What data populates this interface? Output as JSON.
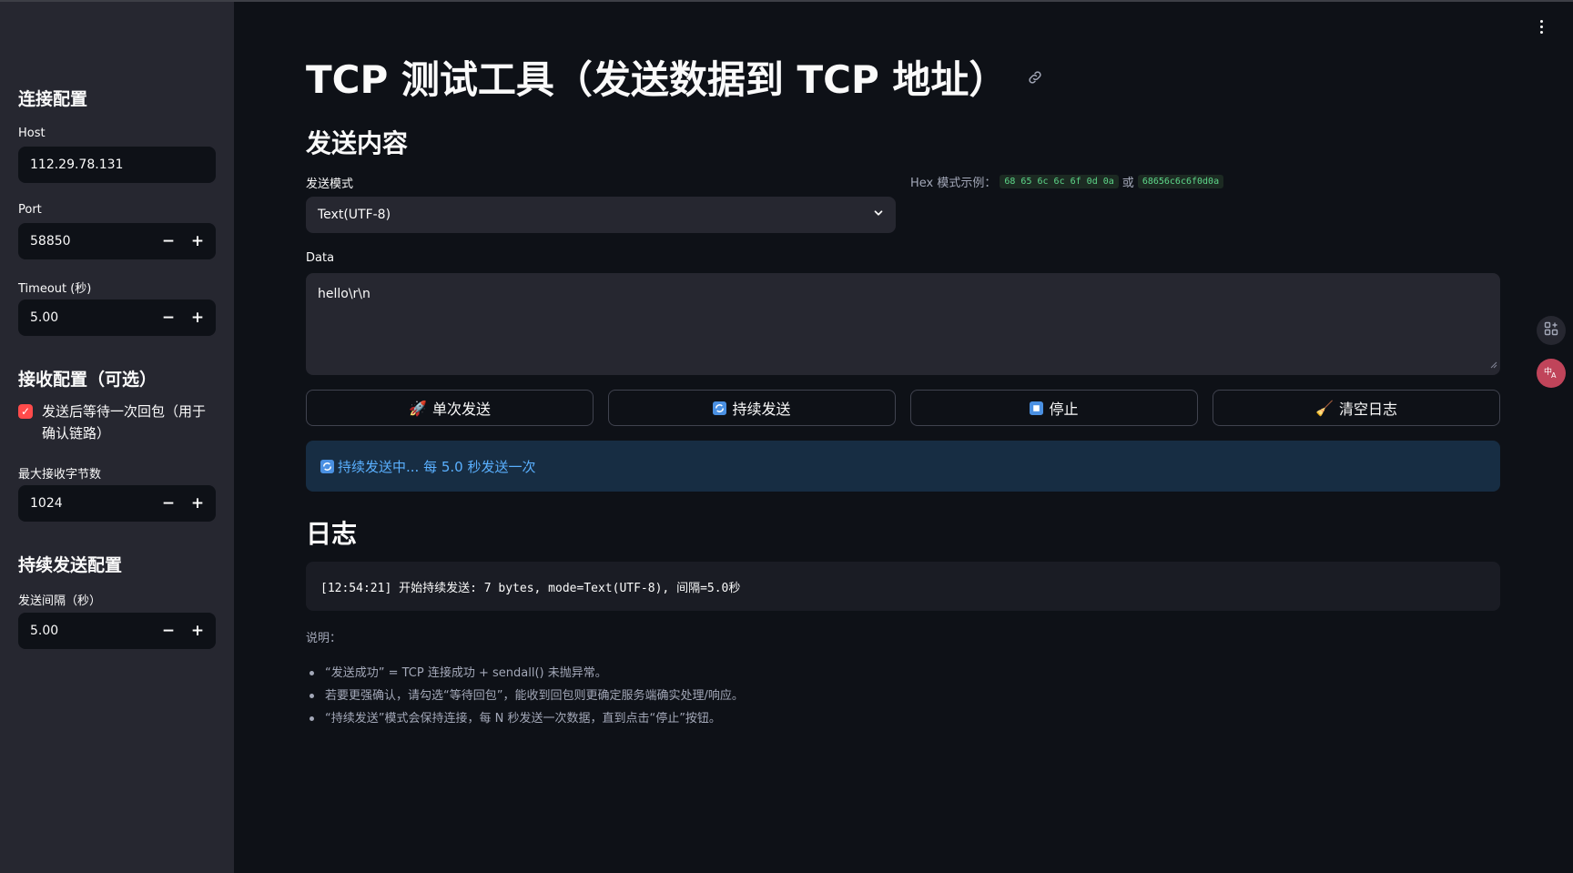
{
  "sidebar": {
    "connection_heading": "连接配置",
    "host": {
      "label": "Host",
      "value": "112.29.78.131"
    },
    "port": {
      "label": "Port",
      "value": "58850"
    },
    "timeout": {
      "label": "Timeout (秒)",
      "value": "5.00"
    },
    "receive_heading": "接收配置（可选）",
    "wait_reply": {
      "label": "发送后等待一次回包（用于确认链路）",
      "checked": true
    },
    "max_bytes": {
      "label": "最大接收字节数",
      "value": "1024"
    },
    "continuous_heading": "持续发送配置",
    "interval": {
      "label": "发送间隔（秒）",
      "value": "5.00"
    },
    "minus": "−",
    "plus": "+"
  },
  "main": {
    "title": "TCP 测试工具（发送数据到 TCP 地址）",
    "send_heading": "发送内容",
    "mode": {
      "label": "发送模式",
      "value": "Text(UTF-8)"
    },
    "hex_hint": {
      "prefix": "Hex 模式示例：",
      "example1": "68 65 6c 6c 6f 0d 0a",
      "or": "或",
      "example2": "68656c6c6f0d0a"
    },
    "data": {
      "label": "Data",
      "value": "hello\\r\\n"
    },
    "buttons": {
      "single": "单次发送",
      "continuous": "持续发送",
      "stop": "停止",
      "clear": "清空日志"
    },
    "status": "持续发送中... 每 5.0 秒发送一次",
    "log_heading": "日志",
    "log_line": "[12:54:21] 开始持续发送: 7 bytes, mode=Text(UTF-8), 间隔=5.0秒",
    "notes_title": "说明：",
    "notes": [
      "“发送成功” = TCP 连接成功 + sendall() 未抛异常。",
      "若要更强确认，请勾选“等待回包”，能收到回包则更确定服务端确实处理/响应。",
      "“持续发送”模式会保持连接，每 N 秒发送一次数据，直到点击“停止”按钮。"
    ]
  },
  "colors": {
    "accent": "#ff4b4b",
    "info": "#5ab0ff",
    "background": "#0e1117",
    "sidebar": "#262730"
  }
}
